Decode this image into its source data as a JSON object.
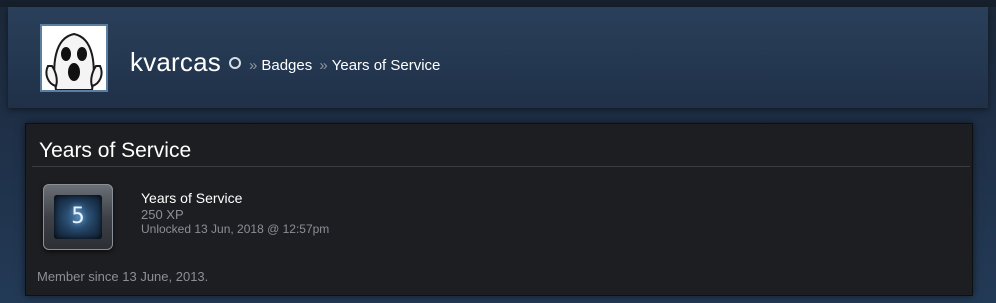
{
  "profile": {
    "username": "kvarcas",
    "avatar_icon": "ghost-face-icon",
    "status_icon": "online-status-ring-icon"
  },
  "breadcrumb": {
    "separator": "»",
    "items": [
      "Badges",
      "Years of Service"
    ]
  },
  "badge_panel": {
    "title": "Years of Service",
    "badge": {
      "icon": "years-of-service-badge-icon",
      "level": "5",
      "name": "Years of Service",
      "xp": "250 XP",
      "unlocked": "Unlocked 13 Jun, 2018 @ 12:57pm"
    },
    "member_since": "Member since 13 June, 2013."
  },
  "colors": {
    "background": "#1b2838",
    "panel": "#1d1e21",
    "muted_text": "#8a8f96",
    "text": "#ffffff"
  }
}
